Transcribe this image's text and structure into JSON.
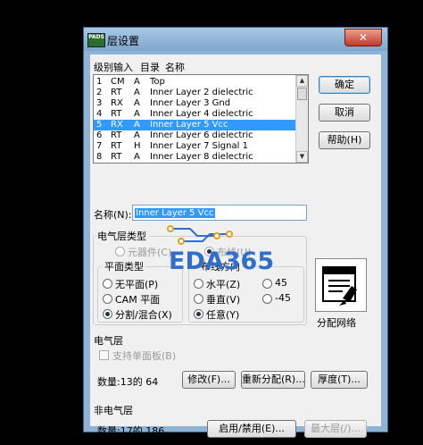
{
  "window": {
    "title": "层设置",
    "app_icon_text": "PADS",
    "close_symbol": "✕"
  },
  "list_header": {
    "level_input": "级别输入",
    "directory": "目录",
    "name": "名称"
  },
  "layers": [
    {
      "num": "1",
      "type": "CM",
      "dir": "A",
      "name": "Top",
      "selected": false
    },
    {
      "num": "2",
      "type": "RT",
      "dir": "A",
      "name": "Inner Layer 2 dielectric",
      "selected": false
    },
    {
      "num": "3",
      "type": "RX",
      "dir": "A",
      "name": "Inner Layer 3 Gnd",
      "selected": false
    },
    {
      "num": "4",
      "type": "RT",
      "dir": "A",
      "name": "Inner Layer 4 dielectric",
      "selected": false
    },
    {
      "num": "5",
      "type": "RX",
      "dir": "A",
      "name": "Inner Layer 5 Vcc",
      "selected": true
    },
    {
      "num": "6",
      "type": "RT",
      "dir": "A",
      "name": "Inner Layer 6 dielectric",
      "selected": false
    },
    {
      "num": "7",
      "type": "RT",
      "dir": "H",
      "name": "Inner Layer 7 Signal 1",
      "selected": false
    },
    {
      "num": "8",
      "type": "RT",
      "dir": "A",
      "name": "Inner Layer 8 dielectric",
      "selected": false
    }
  ],
  "buttons": {
    "ok": "确定",
    "cancel": "取消",
    "help": "帮助(H)",
    "modify": "修改(F)...",
    "reassign": "重新分配(R)...",
    "thickness": "厚度(T)...",
    "enable_disable": "启用/禁用(E)...",
    "max_layers": "最大层(/)..."
  },
  "name_field": {
    "label": "名称(N):",
    "value": "Inner Layer 5 Vcc"
  },
  "electrical_layer_type": {
    "label": "电气层类型",
    "component": "元器件(C)",
    "routing": "布线(U)"
  },
  "plane_type": {
    "label": "平面类型",
    "none": "无平面(P)",
    "cam": "CAM 平面",
    "split_mixed": "分割/混合(X)"
  },
  "routing_direction": {
    "label": "布线方向",
    "horizontal": "水平(Z)",
    "vertical": "垂直(V)",
    "any": "任意(Y)",
    "deg45": "45",
    "deg_neg45": "-45"
  },
  "assign_nets_label": "分配网络",
  "electrical_layers": {
    "label": "电气层",
    "single_sided": "支持单面板(B)",
    "count": "数量:13的 64"
  },
  "non_electrical_layers": {
    "label": "非电气层",
    "count": "数量:17的 186"
  },
  "watermark": "EDA365",
  "colors": {
    "selection": "#3399ff",
    "title_bar": "#8fb3d4",
    "watermark": "#2f6ec9"
  }
}
